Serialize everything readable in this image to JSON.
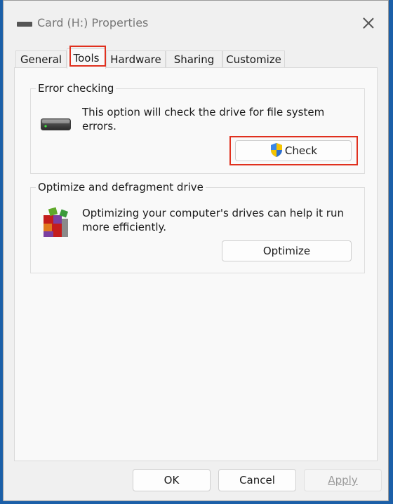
{
  "window": {
    "title": "Card (H:) Properties"
  },
  "tabs": [
    {
      "label": "General"
    },
    {
      "label": "Tools"
    },
    {
      "label": "Hardware"
    },
    {
      "label": "Sharing"
    },
    {
      "label": "Customize"
    }
  ],
  "error_checking": {
    "legend": "Error checking",
    "description": "This option will check the drive for file system errors.",
    "button_label": "Check"
  },
  "optimize": {
    "legend": "Optimize and defragment drive",
    "description": "Optimizing your computer's drives can help it run more efficiently.",
    "button_label": "Optimize"
  },
  "footer": {
    "ok_label": "OK",
    "cancel_label": "Cancel",
    "apply_label": "Apply"
  },
  "colors": {
    "highlight": "#e0301e",
    "desktop": "#1b5fa8"
  }
}
